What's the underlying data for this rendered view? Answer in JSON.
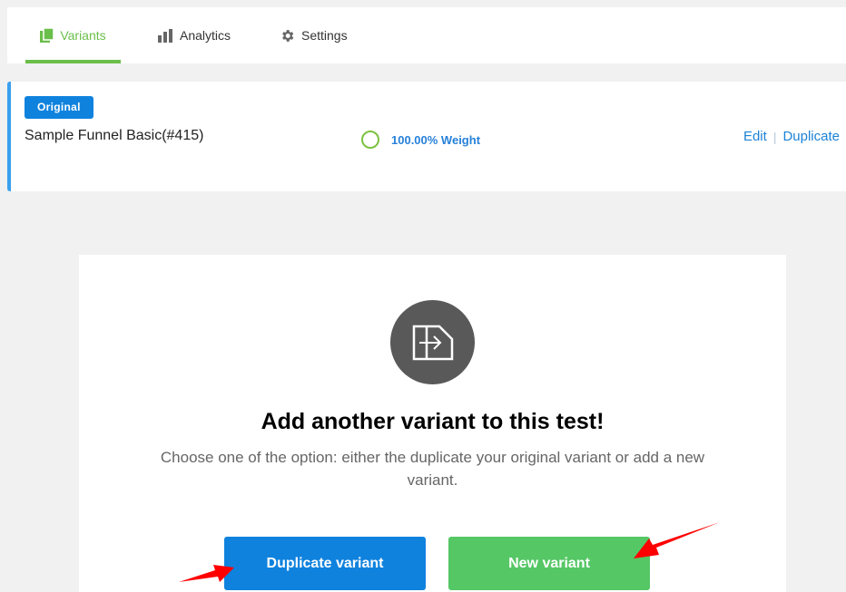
{
  "tabs": [
    {
      "label": "Variants",
      "icon": "copy-icon",
      "active": true
    },
    {
      "label": "Analytics",
      "icon": "bar-chart-icon",
      "active": false
    },
    {
      "label": "Settings",
      "icon": "gear-icon",
      "active": false
    }
  ],
  "variant": {
    "badge": "Original",
    "name": "Sample Funnel Basic(#415)",
    "weight": "100.00% Weight",
    "actions": {
      "edit": "Edit",
      "separator": "|",
      "duplicate": "Duplicate"
    }
  },
  "empty_state": {
    "icon": "split-page-icon",
    "title": "Add another variant to this test!",
    "description": "Choose one of the option: either the duplicate your original variant or add a new variant.",
    "duplicate_button": "Duplicate variant",
    "new_button": "New variant"
  },
  "colors": {
    "accent_green": "#6abf4b",
    "primary_blue": "#0f82de",
    "button_green": "#55c765",
    "link_blue": "#1c82d6",
    "annotation_red": "#ff0000"
  }
}
